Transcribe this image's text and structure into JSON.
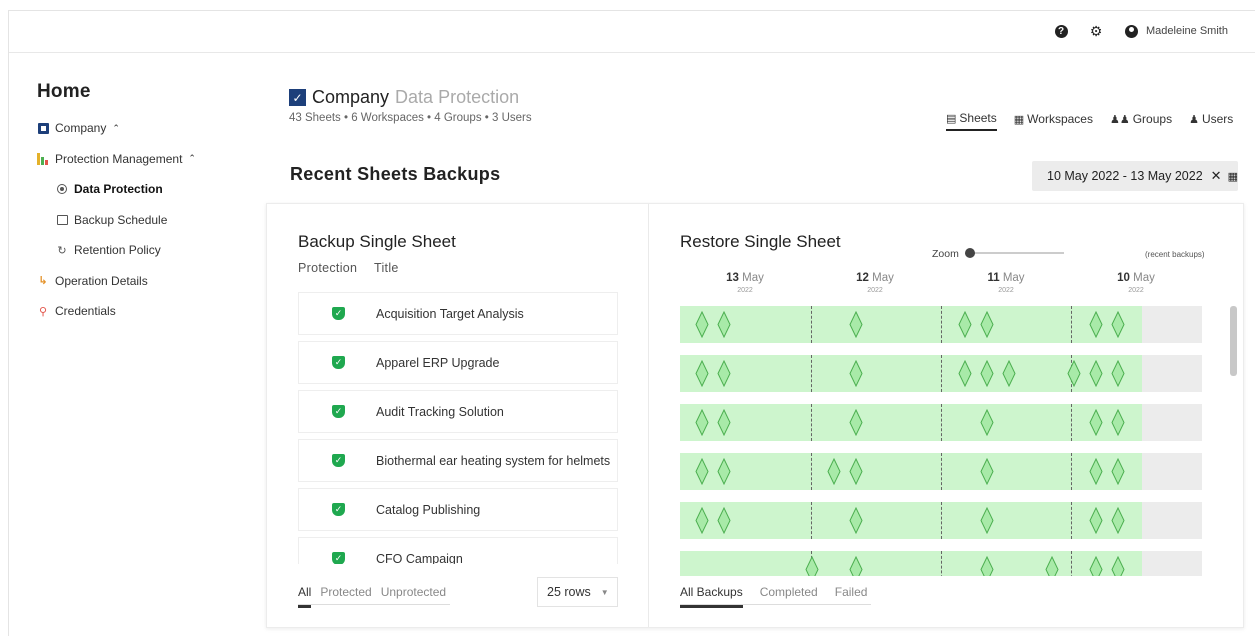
{
  "topbar": {
    "username": "Madeleine Smith",
    "icons": [
      "help-icon",
      "gear-icon",
      "user-circle-icon"
    ]
  },
  "sidebar": {
    "home": "Home",
    "items": [
      {
        "label": "Company",
        "icon": "company-logo-icon",
        "expanded": true,
        "level": 0
      },
      {
        "label": "Protection Management",
        "icon": "chart-icon",
        "expanded": true,
        "level": 0
      },
      {
        "label": "Data Protection",
        "icon": "target-icon",
        "active": true,
        "level": 1
      },
      {
        "label": "Backup Schedule",
        "icon": "calendar-icon",
        "level": 1
      },
      {
        "label": "Retention Policy",
        "icon": "retention-icon",
        "level": 1
      },
      {
        "label": "Operation Details",
        "icon": "operation-icon",
        "level": 0
      },
      {
        "label": "Credentials",
        "icon": "key-icon",
        "level": 0
      }
    ]
  },
  "header": {
    "title_main": "Company",
    "title_sub": "Data Protection",
    "subtitle": "43 Sheets  • 6 Workspaces  • 4 Groups  • 3 Users"
  },
  "view_tabs": [
    {
      "label": "Sheets",
      "icon": "sheet-icon",
      "active": true
    },
    {
      "label": "Workspaces",
      "icon": "grid-icon"
    },
    {
      "label": "Groups",
      "icon": "group-icon"
    },
    {
      "label": "Users",
      "icon": "user-icon"
    }
  ],
  "section_title": "Recent Sheets Backups",
  "date_range": "10 May 2022 - 13 May 2022",
  "backup": {
    "title": "Backup Single Sheet",
    "col_protection": "Protection",
    "col_title": "Title",
    "rows": [
      "Acquisition Target Analysis",
      "Apparel ERP Upgrade",
      "Audit Tracking Solution",
      "Biothermal ear heating system for helmets",
      "Catalog Publishing",
      "CFO Campaign"
    ],
    "filters": [
      "All",
      "Protected",
      "Unprotected"
    ],
    "rows_select": "25 rows"
  },
  "restore": {
    "title": "Restore Single Sheet",
    "zoom_label": "Zoom",
    "zoom_level": 0.0,
    "recent_label": "(recent backups)",
    "dates": [
      {
        "day": "13",
        "month": "May",
        "year": "2022"
      },
      {
        "day": "12",
        "month": "May",
        "year": "2022"
      },
      {
        "day": "11",
        "month": "May",
        "year": "2022"
      },
      {
        "day": "10",
        "month": "May",
        "year": "2022"
      }
    ],
    "filters": [
      "All Backups",
      "Completed",
      "Failed"
    ]
  },
  "colors": {
    "accent": "#1fa84f",
    "brand": "#1d3f7a",
    "timeline_green": "#cdf5cd",
    "diamond_fill": "#a8eaa8",
    "diamond_stroke": "#4caf50"
  }
}
